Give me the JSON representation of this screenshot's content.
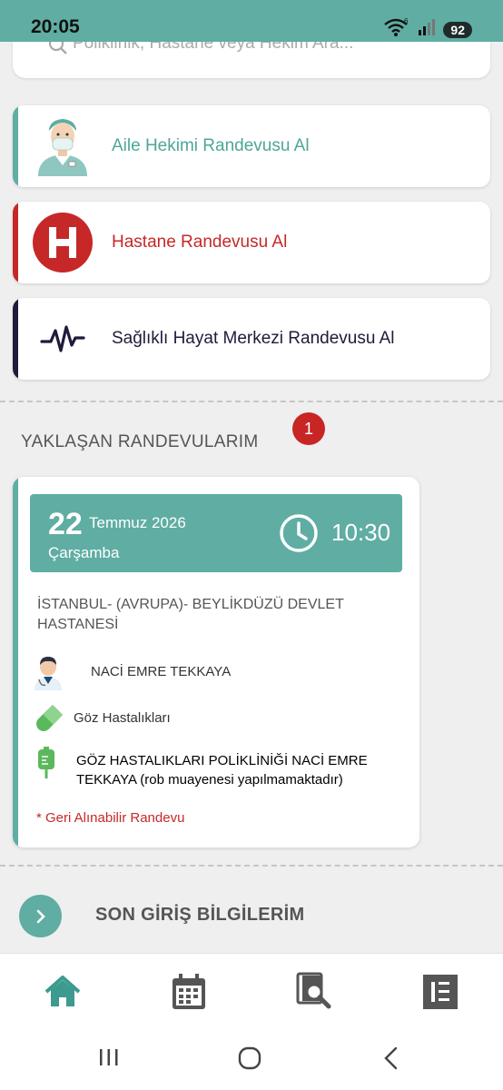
{
  "status_bar": {
    "time": "20:05",
    "wifi_badge": "6",
    "battery": "92"
  },
  "search": {
    "placeholder": "Poliklinik, Hastane veya Hekim Ara..."
  },
  "menu": [
    {
      "label": "Aile Hekimi Randevusu Al",
      "color": "#4ea699",
      "icon": "doctor-avatar-icon"
    },
    {
      "label": "Hastane Randevusu Al",
      "color": "#c62828",
      "icon": "hospital-h-icon"
    },
    {
      "label": "Sağlıklı Hayat Merkezi Randevusu Al",
      "color": "#1f1b3a",
      "icon": "pulse-icon"
    }
  ],
  "upcoming": {
    "title": "YAKLAŞAN RANDEVULARIM",
    "count": "1",
    "appointment": {
      "day": "22",
      "month_year": "Temmuz 2026",
      "weekday": "Çarşamba",
      "time": "10:30",
      "hospital": "İSTANBUL- (AVRUPA)- BEYLİKDÜZÜ DEVLET HASTANESİ",
      "doctor": "NACİ EMRE TEKKAYA",
      "department": "Göz Hastalıkları",
      "clinic": "GÖZ HASTALIKLARI POLİKLİNİĞİ NACİ EMRE TEKKAYA (rob muayenesi yapılmamaktadır)",
      "cancel_note": "* Geri Alınabilir Randevu"
    }
  },
  "last_login": {
    "label": "SON GİRİŞ BİLGİLERİM"
  },
  "colors": {
    "primary": "#5fada3",
    "danger": "#c62828",
    "dark": "#1f1b3a"
  },
  "bottom_nav": [
    "home-icon",
    "calendar-icon",
    "document-search-icon",
    "list-icon"
  ],
  "system_nav": [
    "recent-apps-icon",
    "home-circle-icon",
    "back-icon"
  ]
}
